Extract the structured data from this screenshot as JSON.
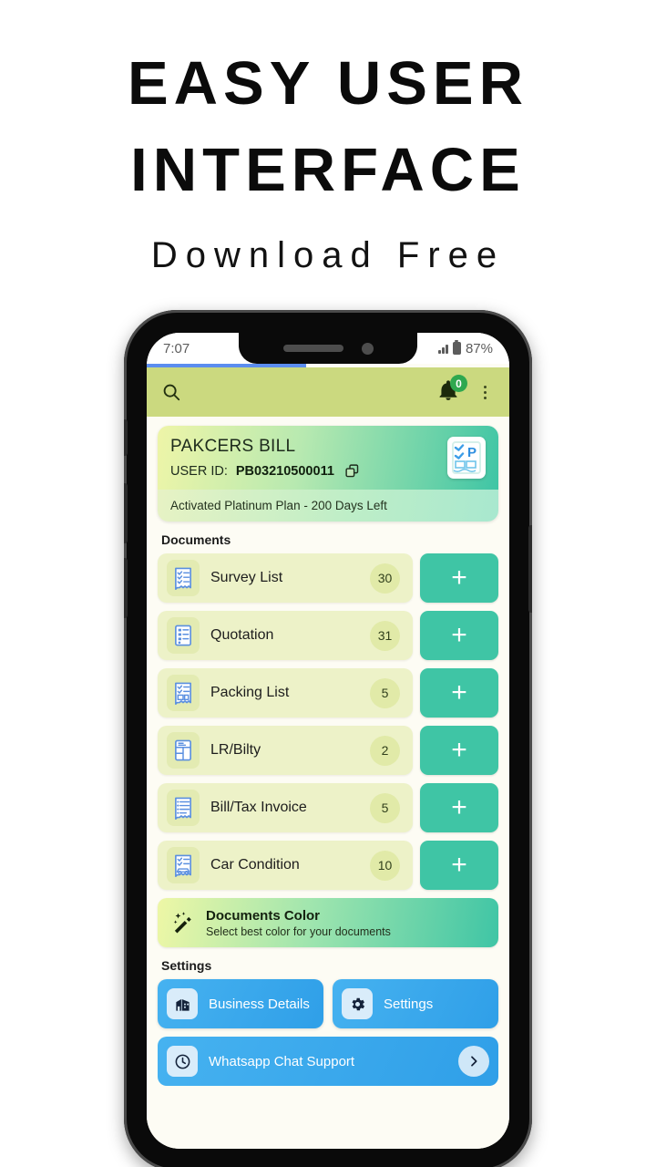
{
  "promo": {
    "line1": "EASY USER",
    "line2": "INTERFACE",
    "subtitle": "Download Free"
  },
  "phone": {
    "status_bar": {
      "time": "7:07",
      "battery_percent": "87%",
      "signal_icon": "signal-bars-icon",
      "battery_icon": "battery-icon"
    },
    "loading_bar_percent": "44"
  },
  "app_bar": {
    "search_icon": "search-icon",
    "notification_icon": "bell-icon",
    "notification_count": "0",
    "overflow_icon": "kebab-menu-icon"
  },
  "profile": {
    "business_name": "PAKCERS BILL",
    "user_id_label": "USER ID:",
    "user_id_value": "PB03210500011",
    "copy_icon": "copy-icon",
    "logo_icon": "app-logo-icon",
    "plan_status": "Activated Platinum Plan - 200 Days Left"
  },
  "documents": {
    "section_title": "Documents",
    "add_label": "+",
    "rows": [
      {
        "name": "Survey List",
        "count": "30",
        "icon": "checklist-receipt-icon"
      },
      {
        "name": "Quotation",
        "count": "31",
        "icon": "quotation-document-icon"
      },
      {
        "name": "Packing List",
        "count": "5",
        "icon": "packing-list-icon"
      },
      {
        "name": "LR/Bilty",
        "count": "2",
        "icon": "bilty-document-icon"
      },
      {
        "name": "Bill/Tax Invoice",
        "count": "5",
        "icon": "invoice-icon"
      },
      {
        "name": "Car Condition",
        "count": "10",
        "icon": "car-condition-icon"
      }
    ]
  },
  "documents_color": {
    "title": "Documents Color",
    "subtitle": "Select best color for your documents",
    "icon": "magic-wand-icon"
  },
  "settings": {
    "section_title": "Settings",
    "tiles": [
      {
        "label": "Business Details",
        "icon": "building-icon"
      },
      {
        "label": "Settings",
        "icon": "gear-icon"
      }
    ],
    "support": {
      "label": "Whatsapp Chat Support",
      "icon": "clock-icon",
      "arrow_icon": "chevron-right-icon"
    }
  },
  "colors": {
    "app_bar": "#cbd97f",
    "accent_teal": "#3fc5a5",
    "accent_blue": "#2f9fe8",
    "badge_green": "#2fa84f",
    "row_bg": "#edf2c8",
    "loading_blue": "#5b8def"
  }
}
